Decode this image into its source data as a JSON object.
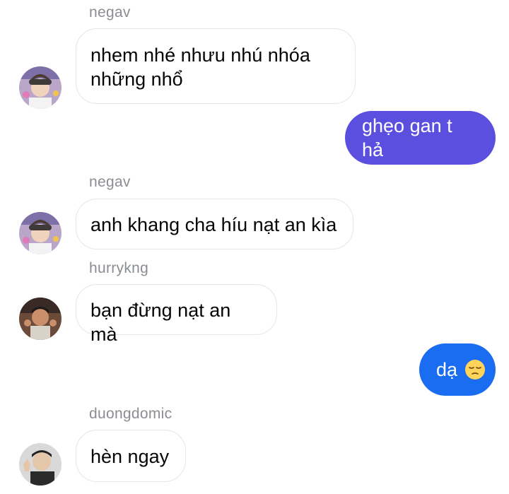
{
  "colors": {
    "outgoing_1": "#5b4fe0",
    "outgoing_2": "#1a6cf0",
    "incoming_border": "#e4e6eb",
    "username": "#8a8d91"
  },
  "messages": [
    {
      "type": "incoming",
      "sender": "negav",
      "text": "nhem nhé nhưu nhú nhóa những nhổ",
      "avatar": "avatar-negav"
    },
    {
      "type": "outgoing",
      "text": "ghẹo gan t hả"
    },
    {
      "type": "incoming",
      "sender": "negav",
      "text": "anh khang cha híu nạt an kìa",
      "avatar": "avatar-negav"
    },
    {
      "type": "incoming",
      "sender": "hurrykng",
      "text": "bạn đừng nạt an mà",
      "avatar": "avatar-hurrykng"
    },
    {
      "type": "outgoing",
      "text": "dạ",
      "emoji": "pensive-face-emoji"
    },
    {
      "type": "incoming",
      "sender": "duongdomic",
      "text": "hèn ngay",
      "avatar": "avatar-duongdomic"
    }
  ]
}
